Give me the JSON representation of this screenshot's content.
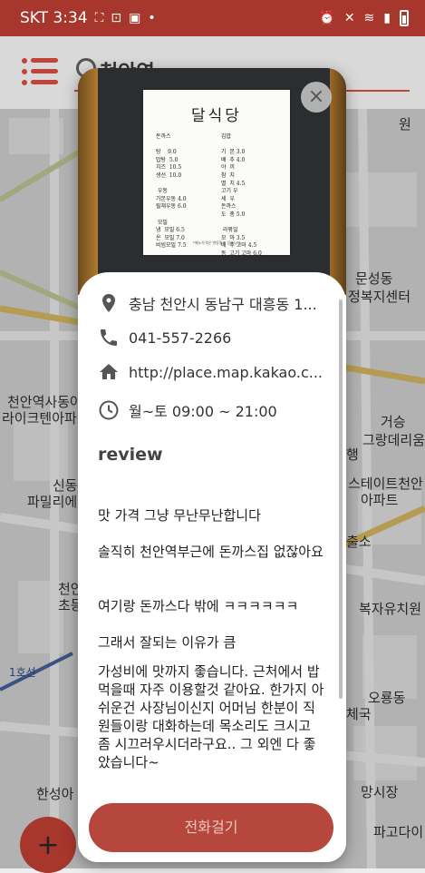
{
  "status_bar": {
    "carrier_time": "SKT 3:34",
    "left_icons": [
      "screen-capture-icon",
      "photo-icon",
      "dot-icon"
    ],
    "right_icons": [
      "alarm-icon",
      "mute-icon",
      "wifi-icon",
      "signal-icon",
      "battery-icon"
    ]
  },
  "app_bar": {
    "search_text": "천안역"
  },
  "map": {
    "labels": {
      "l1": "원",
      "l2": "문성동",
      "l3": "정복지센터",
      "l4": "천안역사동아",
      "l5": "라이크텐아파",
      "l6": "거승",
      "l7": "그랑데리움",
      "l8": "행",
      "l9": "스테이트천안",
      "l10": "아파트",
      "l11": "신동",
      "l12": "파밀리에",
      "l13": "출소",
      "l14": "천안",
      "l15": "초등",
      "l16": "복자유치원",
      "l17": "오룡동",
      "l18": "체국",
      "l19": "1호선",
      "l20": "한성아",
      "l21": "망시장",
      "l22": "파고다이"
    }
  },
  "fab": {
    "label": "+"
  },
  "popup": {
    "photo": {
      "menu_title": "달식당",
      "menu_left": "돈까스\n\n탕    9.0\n밥탕  5.0\n치즈  10.5\n생선  10.0\n\n 우동\n기본우동 4.0\n릴채우동 6.0\n\n 모밀\n냉  모밀 6.5\n온  모밀 7.0\n비빔모밀 7.5",
      "menu_right": "김밥\n\n기  본 3.0\n배  추 4.0\n야  끼\n참  치\n멸  치 4.5\n고기 우\n세  우\n돈까스\n도  총 5.0\n\n 라볶일\n모  마 3.5\n배  추 고마 4.5\n동  고기 고마 6.0",
      "menu_footer": "*메뉴가격은 변동될수 있습니다"
    },
    "close_label": "×",
    "address": "충남 천안시 동남구 대흥동 1...",
    "phone": "041-557-2266",
    "homepage": "http://place.map.kakao.c...",
    "hours": "월~토 09:00 ~ 21:00",
    "review_title": "review",
    "reviews": [
      "맛 가격 그냥 무난무난합니다",
      "솔직히 천안역부근에 돈까스집 없잖아요",
      "여기랑 돈까스다 밖에 ㅋㅋㅋㅋㅋㅋ",
      "그래서 잘되는 이유가 큼",
      "가성비에 맛까지 좋습니다. 근처에서 밥먹을때 자주 이용할것 같아요. 한가지 아쉬운건 사장님이신지 어머님 한분이 직원들이랑 대화하는데 목소리도 크시고 좀 시끄러우시더라구요.. 그 외엔 다 좋았습니다~"
    ],
    "call_button": "전화걸기",
    "icons": {
      "address": "location-pin-icon",
      "phone": "phone-icon",
      "homepage": "home-icon",
      "hours": "clock-icon"
    }
  },
  "colors": {
    "primary": "#a7362c",
    "call_button": "#b5473c"
  }
}
